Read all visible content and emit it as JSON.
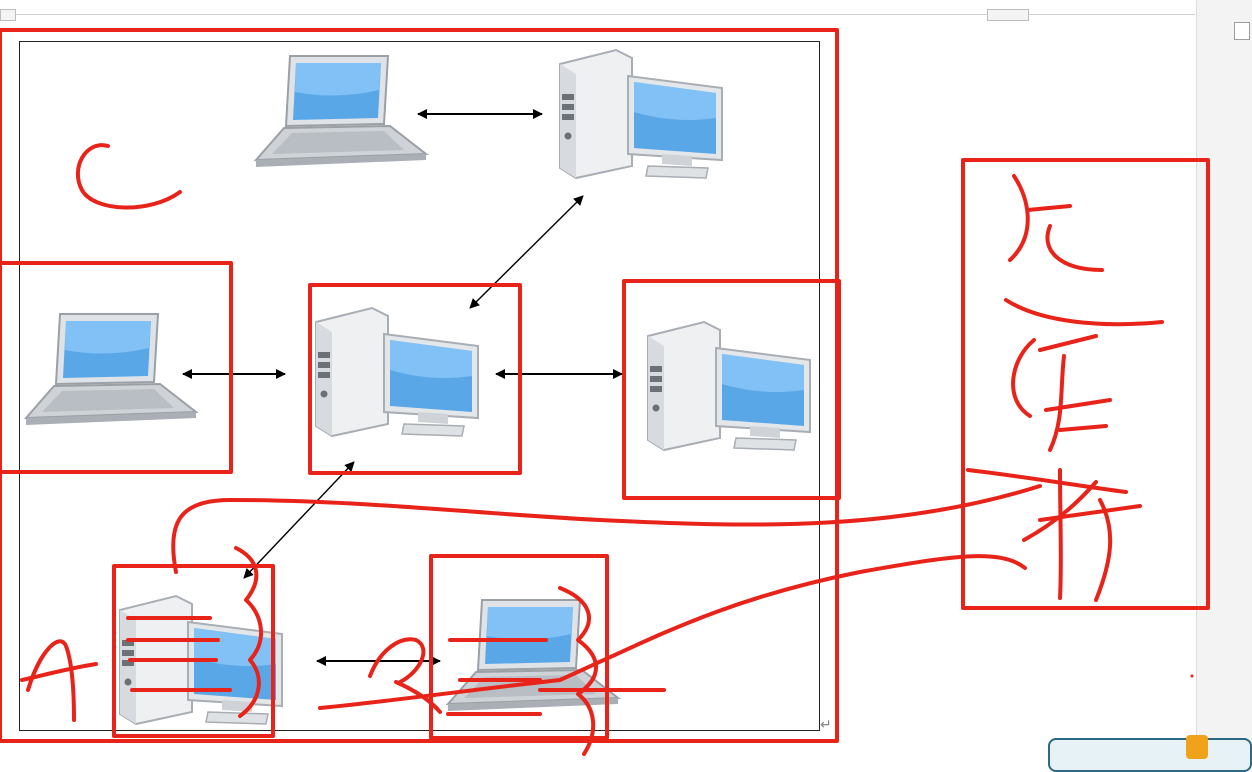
{
  "window": {
    "resize_glyph": "↵"
  },
  "diagram": {
    "nodes": [
      {
        "id": "laptop-top",
        "kind": "laptop-icon"
      },
      {
        "id": "desktop-top-right",
        "kind": "desktop-icon"
      },
      {
        "id": "laptop-left",
        "kind": "laptop-icon"
      },
      {
        "id": "desktop-center",
        "kind": "desktop-icon"
      },
      {
        "id": "desktop-right",
        "kind": "desktop-icon"
      },
      {
        "id": "desktop-bottom-left",
        "kind": "desktop-icon"
      },
      {
        "id": "laptop-bottom",
        "kind": "laptop-icon"
      }
    ],
    "connections": [
      [
        "laptop-top",
        "desktop-top-right"
      ],
      [
        "desktop-top-right",
        "desktop-center"
      ],
      [
        "laptop-left",
        "desktop-center"
      ],
      [
        "desktop-center",
        "desktop-right"
      ],
      [
        "desktop-center",
        "desktop-bottom-left"
      ],
      [
        "desktop-bottom-left",
        "laptop-bottom"
      ]
    ]
  },
  "colors": {
    "annotation": "#e8231a",
    "screen": "#5aa7e8",
    "case": "#e9ecef",
    "frame": "#222222"
  }
}
